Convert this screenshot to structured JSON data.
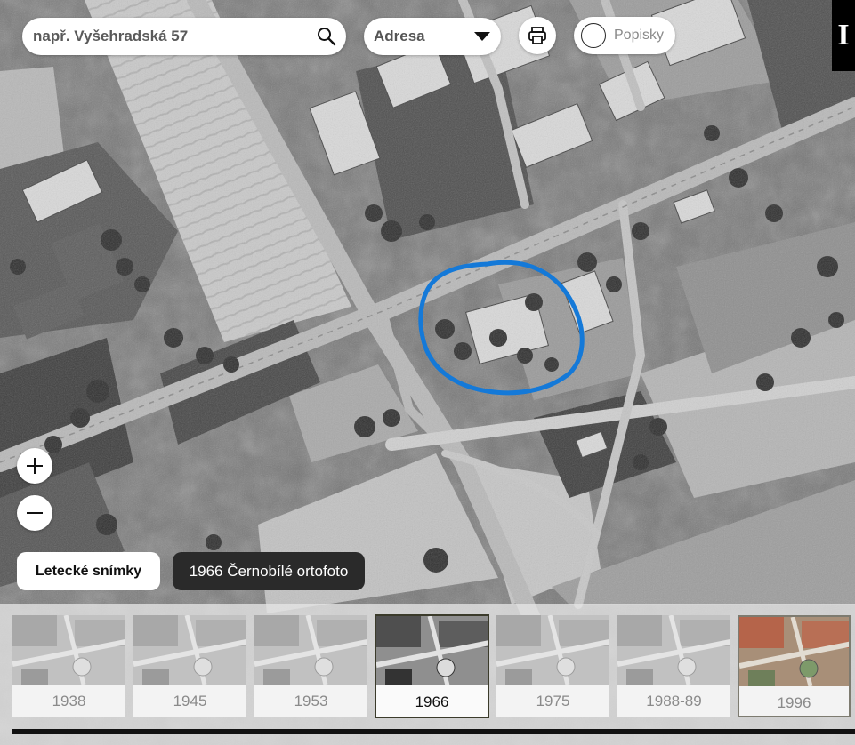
{
  "search": {
    "placeholder": "např. Vyšehradská 57"
  },
  "search_type": {
    "selected": "Adresa"
  },
  "labels_toggle": {
    "label": "Popisky"
  },
  "info_button": {
    "label": "I"
  },
  "zoom": {
    "in_label": "+",
    "out_label": "−"
  },
  "layer": {
    "category_label": "Letecké snímky",
    "current_label": "1966 Černobílé ortofoto"
  },
  "timeline": {
    "items": [
      {
        "year": "1938",
        "color": "grayscale"
      },
      {
        "year": "1945",
        "color": "grayscale"
      },
      {
        "year": "1953",
        "color": "grayscale"
      },
      {
        "year": "1966",
        "color": "grayscale",
        "active": true
      },
      {
        "year": "1975",
        "color": "grayscale"
      },
      {
        "year": "1988-89",
        "color": "grayscale"
      },
      {
        "year": "1996",
        "color": "colour"
      }
    ]
  },
  "colors": {
    "highlight_outline": "#1479d8",
    "panel_dark": "#2a2a2a",
    "info_bg": "#000000"
  },
  "icons": [
    "search-icon",
    "chevron-down-icon",
    "printer-icon",
    "toggle-circle-icon",
    "info-icon",
    "zoom-in-icon",
    "zoom-out-icon"
  ]
}
